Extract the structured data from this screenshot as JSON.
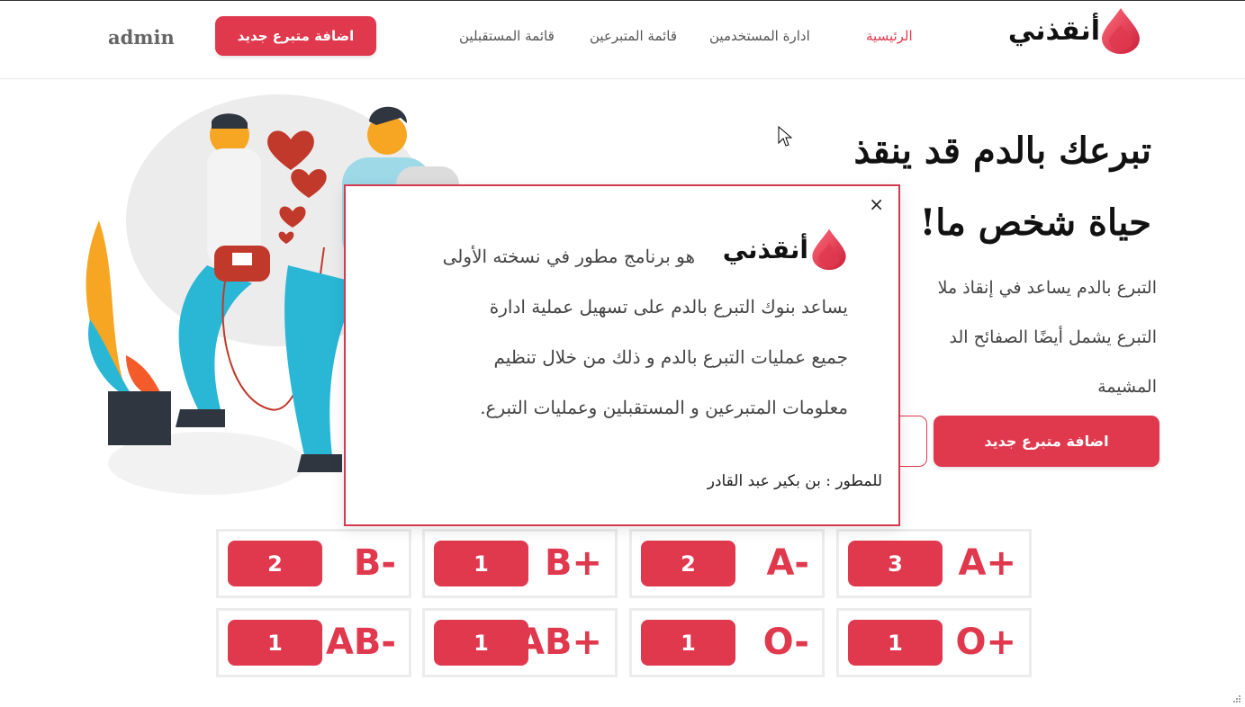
{
  "nav": {
    "brand": "أنقذني",
    "links": [
      "الرئيسية",
      "ادارة المستخدمين",
      "قائمة المتبرعين",
      "قائمة المستقبلين"
    ],
    "add_button": "اضافة متبرع جديد",
    "user": "admin"
  },
  "hero": {
    "title_line1": "تبرعك بالدم قد ينقذ",
    "title_line2": "حياة شخص ما!",
    "text_line1": "التبرع بالدم يساعد في إنقاذ ملا",
    "text_line2": "التبرع يشمل أيضًا الصفائح الد",
    "text_line3": "المشيمة",
    "add_button": "اضافة متبرع جديد"
  },
  "modal": {
    "brand": "أنقذني",
    "line1": "هو برنامج مطور في نسخته الأولى",
    "line2": "يساعد بنوك التبرع بالدم على تسهيل عملية ادارة",
    "line3": "جميع عمليات التبرع بالدم و ذلك من خلال تنظيم",
    "line4": "معلومات المتبرعين و المستقبلين وعمليات التبرع.",
    "footer": "للمطور : بن بكير عبد القادر",
    "close": "×"
  },
  "blood_groups": [
    {
      "type": "A+",
      "count": "3"
    },
    {
      "type": "A-",
      "count": "2"
    },
    {
      "type": "B+",
      "count": "1"
    },
    {
      "type": "B-",
      "count": "2"
    },
    {
      "type": "O+",
      "count": "1"
    },
    {
      "type": "O-",
      "count": "1"
    },
    {
      "type": "AB+",
      "count": "1"
    },
    {
      "type": "AB-",
      "count": "1"
    }
  ],
  "colors": {
    "accent": "#e0384d",
    "card_border": "#ececec",
    "text": "#444444"
  },
  "icons": [
    "blood-drop-icon",
    "close-icon",
    "mouse-cursor-icon",
    "resize-grip-icon"
  ]
}
